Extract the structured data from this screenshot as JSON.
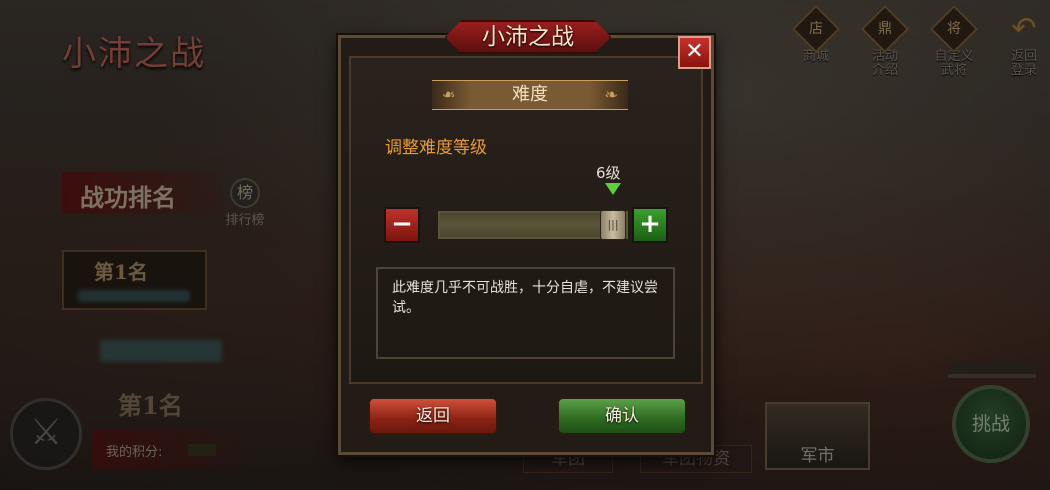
{
  "background": {
    "title": "小沛之战",
    "rank_heading": "战功排名",
    "leaderboard_label": "排行榜",
    "rank_card_title": "第1名",
    "rank_second_title": "第1名",
    "my_score_label": "我的积分:",
    "top_icons": [
      {
        "label": "商城",
        "icon": "shop-icon"
      },
      {
        "label": "活动\n介绍",
        "icon": "event-icon"
      },
      {
        "label": "自定义\n武将",
        "icon": "custom-general-icon"
      },
      {
        "label": "返回\n登录",
        "icon": "back-arrow-icon"
      }
    ],
    "bottom_tabs": [
      "军团",
      "军团物资"
    ],
    "market_label": "军市",
    "challenge_label": "挑战"
  },
  "dialog": {
    "title": "小沛之战",
    "close_symbol": "✕",
    "section_title": "难度",
    "adjust_label": "调整难度等级",
    "level_label": "6级",
    "difficulty": {
      "level": 6,
      "max": 6
    },
    "minus_symbol": "−",
    "plus_symbol": "+",
    "description": "此难度几乎不可战胜，十分自虐，不建议尝试。",
    "back_button": "返回",
    "confirm_button": "确认"
  }
}
